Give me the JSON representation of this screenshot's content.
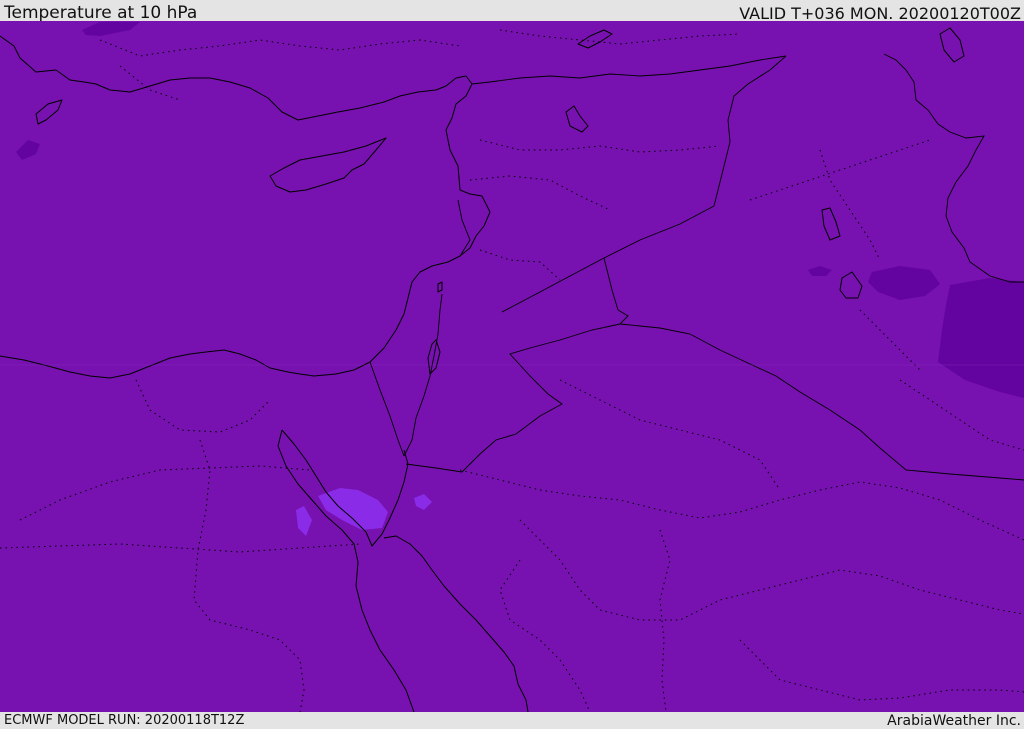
{
  "header": {
    "title": "Temperature at 10 hPa",
    "valid": "VALID T+036 MON. 20200120T00Z"
  },
  "footer": {
    "model_run": "ECMWF MODEL RUN: 20200118T12Z",
    "credit": "ArabiaWeather Inc."
  },
  "map": {
    "field_colors": {
      "base": "#7711b0",
      "colder": "#6404a0",
      "warmer": "#8a2be8"
    },
    "coastline_color": "#000000",
    "border_color": "#000000"
  }
}
